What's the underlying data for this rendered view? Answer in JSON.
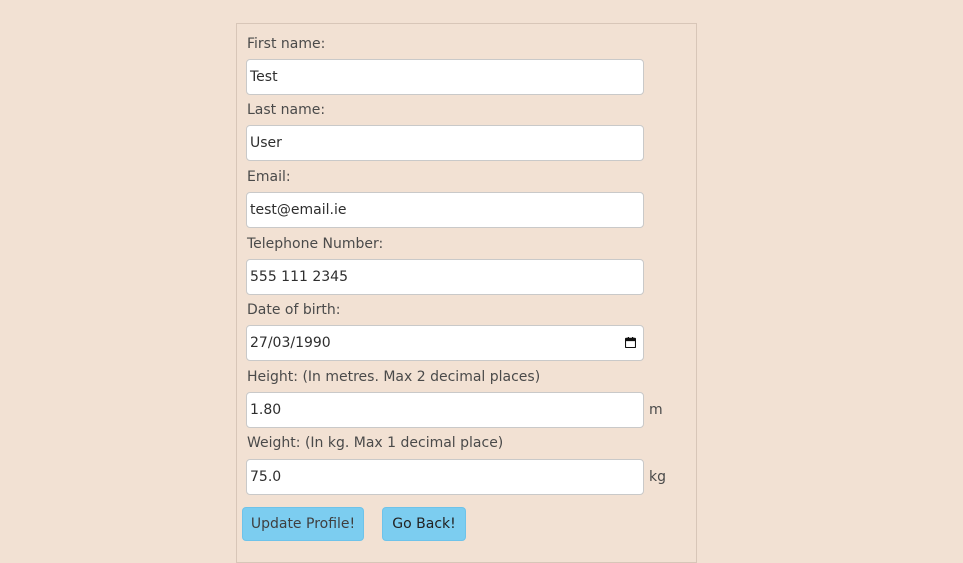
{
  "form": {
    "fields": [
      {
        "label": "First name:",
        "value": "Test"
      },
      {
        "label": "Last name:",
        "value": "User"
      },
      {
        "label": "Email:",
        "value": "test@email.ie"
      },
      {
        "label": "Telephone Number:",
        "value": "555 111 2345"
      },
      {
        "label": "Date of birth:",
        "value": "27/03/1990",
        "icon": "calendar-icon"
      },
      {
        "label": "Height: (In metres. Max 2 decimal places)",
        "value": "1.80",
        "unit": "m"
      },
      {
        "label": "Weight: (In kg. Max 1 decimal place)",
        "value": "75.0",
        "unit": "kg"
      }
    ],
    "buttons": {
      "update_label": "Update Profile!",
      "back_label": "Go Back!"
    }
  },
  "colors": {
    "background": "#f2e1d3",
    "button": "#7ccdf0",
    "input_bg": "#ffffff"
  }
}
